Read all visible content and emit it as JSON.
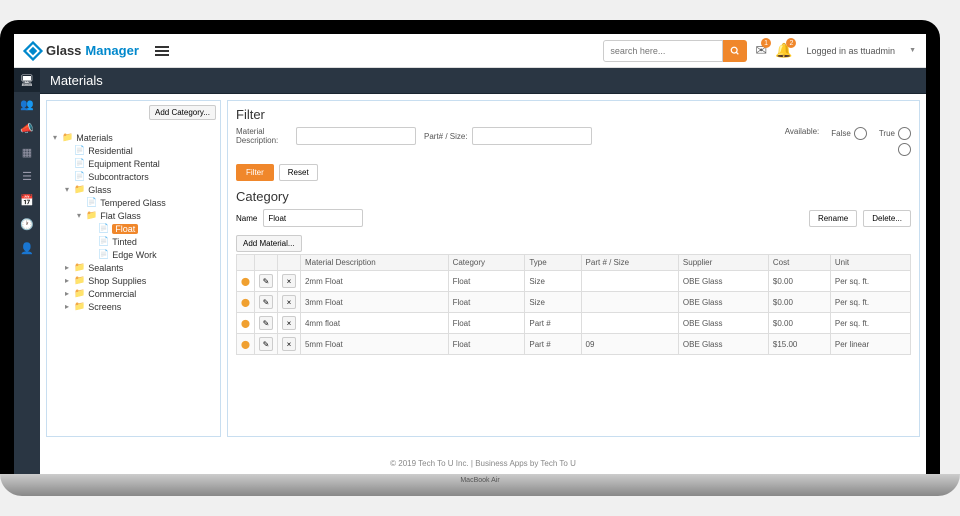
{
  "header": {
    "logo_glass": "Glass",
    "logo_mgr": "Manager",
    "search_placeholder": "search here...",
    "mail_badge": "1",
    "bell_badge": "2",
    "user_text": "Logged in as ttuadmin"
  },
  "page": {
    "title": "Materials"
  },
  "tree": {
    "add_category": "Add Category...",
    "items": [
      {
        "label": "Materials",
        "lvl": 0,
        "caret": "▾",
        "type": "folder"
      },
      {
        "label": "Residential",
        "lvl": 1,
        "caret": "",
        "type": "file"
      },
      {
        "label": "Equipment Rental",
        "lvl": 1,
        "caret": "",
        "type": "file"
      },
      {
        "label": "Subcontractors",
        "lvl": 1,
        "caret": "",
        "type": "file"
      },
      {
        "label": "Glass",
        "lvl": 1,
        "caret": "▾",
        "type": "folder"
      },
      {
        "label": "Tempered Glass",
        "lvl": 2,
        "caret": "",
        "type": "file"
      },
      {
        "label": "Flat Glass",
        "lvl": 2,
        "caret": "▾",
        "type": "folder"
      },
      {
        "label": "Float",
        "lvl": 3,
        "caret": "",
        "type": "file",
        "selected": true
      },
      {
        "label": "Tinted",
        "lvl": 3,
        "caret": "",
        "type": "file"
      },
      {
        "label": "Edge Work",
        "lvl": 3,
        "caret": "",
        "type": "file"
      },
      {
        "label": "Sealants",
        "lvl": 1,
        "caret": "▸",
        "type": "folder"
      },
      {
        "label": "Shop Supplies",
        "lvl": 1,
        "caret": "▸",
        "type": "folder"
      },
      {
        "label": "Commercial",
        "lvl": 1,
        "caret": "▸",
        "type": "folder"
      },
      {
        "label": "Screens",
        "lvl": 1,
        "caret": "▸",
        "type": "folder"
      }
    ]
  },
  "filter": {
    "title": "Filter",
    "material_desc_label": "Material Description:",
    "part_size_label": "Part# / Size:",
    "available_label": "Available:",
    "false_label": "False",
    "true_label": "True",
    "filter_btn": "Filter",
    "reset_btn": "Reset"
  },
  "category": {
    "title": "Category",
    "name_label": "Name",
    "name_value": "Float",
    "rename_btn": "Rename",
    "delete_btn": "Delete...",
    "add_material": "Add Material..."
  },
  "table": {
    "headers": [
      "Material Description",
      "Category",
      "Type",
      "Part # / Size",
      "Supplier",
      "Cost",
      "Unit"
    ],
    "rows": [
      {
        "desc": "2mm Float",
        "cat": "Float",
        "type": "Size",
        "part": "",
        "supplier": "OBE Glass",
        "cost": "$0.00",
        "unit": "Per sq. ft."
      },
      {
        "desc": "3mm Float",
        "cat": "Float",
        "type": "Size",
        "part": "",
        "supplier": "OBE Glass",
        "cost": "$0.00",
        "unit": "Per sq. ft."
      },
      {
        "desc": "4mm float",
        "cat": "Float",
        "type": "Part #",
        "part": "",
        "supplier": "OBE Glass",
        "cost": "$0.00",
        "unit": "Per sq. ft."
      },
      {
        "desc": "5mm Float",
        "cat": "Float",
        "type": "Part #",
        "part": "09",
        "supplier": "OBE Glass",
        "cost": "$15.00",
        "unit": "Per linear"
      }
    ]
  },
  "footer": {
    "text": "© 2019 Tech To U Inc. | Business Apps by Tech To U"
  }
}
